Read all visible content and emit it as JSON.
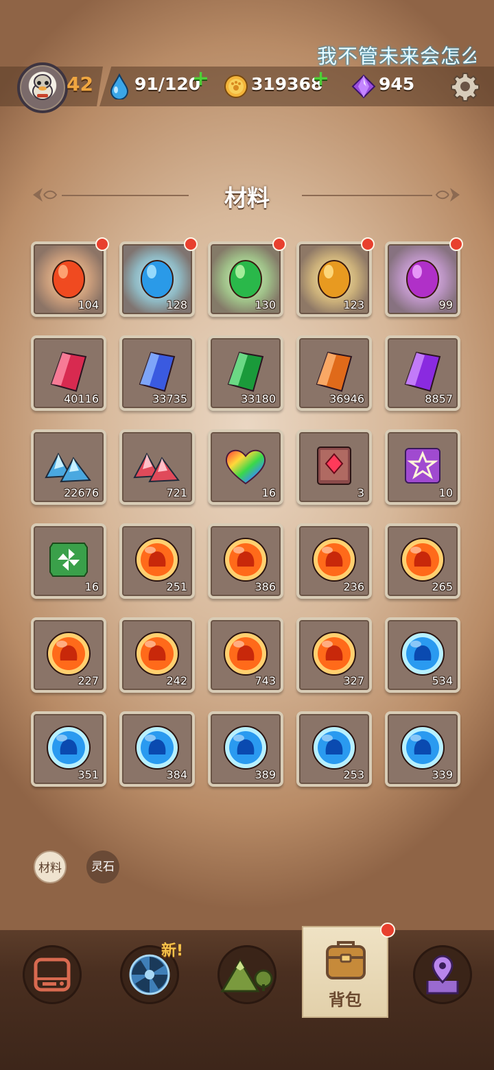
{
  "marquee_text": "我不管未来会怎么",
  "header": {
    "level": "42",
    "energy": "91/120",
    "gold": "319368",
    "gems": "945",
    "icons": [
      "avatar",
      "water-drop-icon",
      "gold-coin-icon",
      "purple-gem-icon",
      "settings-gear-icon"
    ]
  },
  "section_title": "材料",
  "items": [
    {
      "icon": "red-egg",
      "count": "104",
      "badge": true
    },
    {
      "icon": "blue-egg",
      "count": "128",
      "badge": true
    },
    {
      "icon": "green-egg",
      "count": "130",
      "badge": true
    },
    {
      "icon": "gold-egg",
      "count": "123",
      "badge": true
    },
    {
      "icon": "purple-egg",
      "count": "99",
      "badge": true
    },
    {
      "icon": "red-crystal",
      "count": "40116"
    },
    {
      "icon": "blue-crystal",
      "count": "33735"
    },
    {
      "icon": "green-crystal",
      "count": "33180"
    },
    {
      "icon": "orange-crystal",
      "count": "36946"
    },
    {
      "icon": "purple-crystal",
      "count": "8857"
    },
    {
      "icon": "blue-ore",
      "count": "22676"
    },
    {
      "icon": "red-ore",
      "count": "721"
    },
    {
      "icon": "rainbow-heart",
      "count": "16"
    },
    {
      "icon": "red-book",
      "count": "3"
    },
    {
      "icon": "purple-star-card",
      "count": "10"
    },
    {
      "icon": "green-pinwheel-card",
      "count": "16"
    },
    {
      "icon": "fire-orb-devil",
      "count": "251"
    },
    {
      "icon": "fire-orb-house",
      "count": "386"
    },
    {
      "icon": "fire-orb-flame",
      "count": "236"
    },
    {
      "icon": "fire-orb-beast",
      "count": "265"
    },
    {
      "icon": "fire-orb-block",
      "count": "227"
    },
    {
      "icon": "fire-orb-fox",
      "count": "242"
    },
    {
      "icon": "fire-orb-dragon",
      "count": "743"
    },
    {
      "icon": "fire-orb-bull",
      "count": "327"
    },
    {
      "icon": "water-orb-creature",
      "count": "534"
    },
    {
      "icon": "water-orb-bear",
      "count": "351"
    },
    {
      "icon": "water-orb-fish",
      "count": "384"
    },
    {
      "icon": "water-orb-ox",
      "count": "389"
    },
    {
      "icon": "water-orb-bird",
      "count": "253"
    },
    {
      "icon": "water-orb-wolf",
      "count": "339"
    }
  ],
  "filters": [
    {
      "label": "材料",
      "selected": true
    },
    {
      "label": "灵石",
      "selected": false
    }
  ],
  "nav": {
    "new_tag": "新!",
    "active_label": "背包",
    "items": [
      "monitor-icon",
      "portal-icon",
      "mountain-icon",
      "backpack-icon",
      "map-pin-icon"
    ]
  },
  "colors": {
    "badge": "#e8402e",
    "accent_green": "#4ecf38",
    "level_orange": "#f0a640",
    "nav_bg": "#4a2f20"
  }
}
